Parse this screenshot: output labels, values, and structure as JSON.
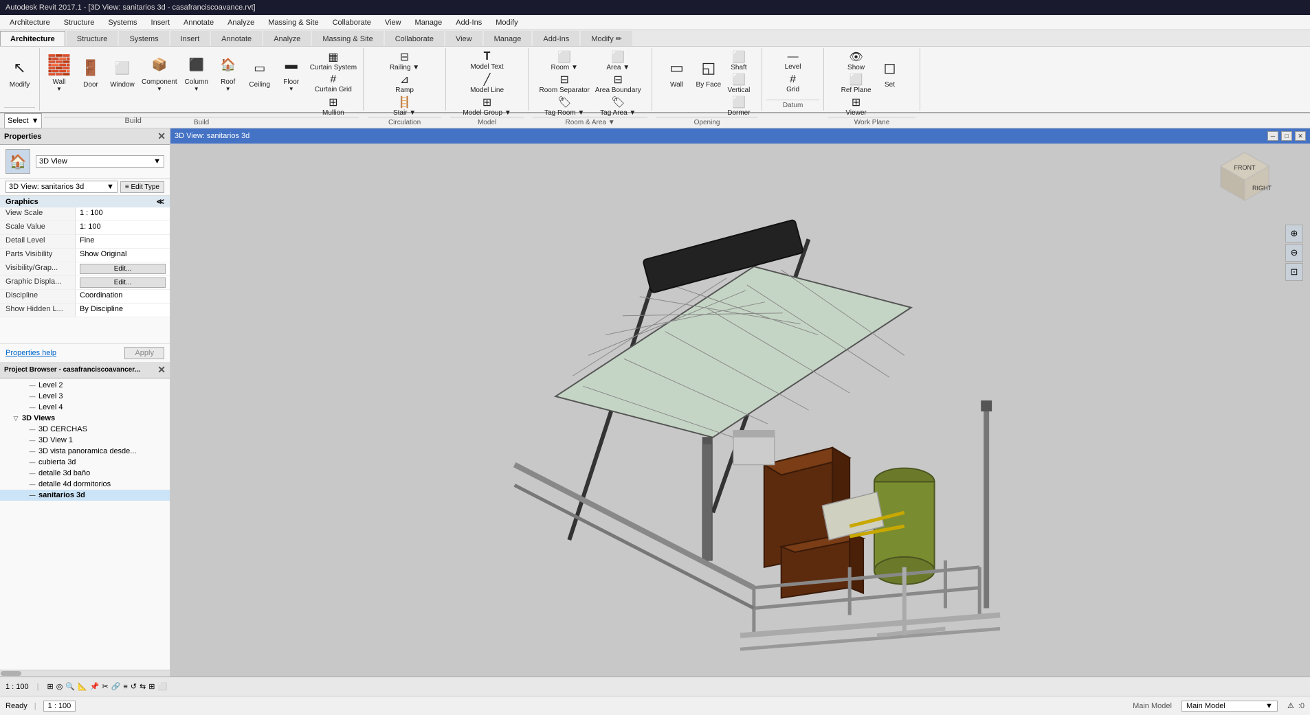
{
  "titleBar": {
    "text": "Autodesk Revit 2017.1 - [3D View: sanitarios 3d - casafranciscoavance.rvt]"
  },
  "menuBar": {
    "items": [
      "Architecture",
      "Structure",
      "Systems",
      "Insert",
      "Annotate",
      "Analyze",
      "Massing & Site",
      "Collaborate",
      "View",
      "Manage",
      "Add-Ins",
      "Modify"
    ]
  },
  "ribbon": {
    "activeTab": "Architecture",
    "tabs": [
      "Architecture",
      "Structure",
      "Systems",
      "Insert",
      "Annotate",
      "Analyze",
      "Massing & Site",
      "Collaborate",
      "View",
      "Manage",
      "Add-Ins",
      "Modify"
    ],
    "groups": {
      "select": {
        "label": ""
      },
      "build": {
        "label": "Build",
        "buttons": [
          {
            "label": "Wall",
            "icon": "🧱"
          },
          {
            "label": "Door",
            "icon": "🚪"
          },
          {
            "label": "Window",
            "icon": "⬜"
          },
          {
            "label": "Component",
            "icon": "📦"
          },
          {
            "label": "Column",
            "icon": "⬜"
          },
          {
            "label": "Roof",
            "icon": "🏠"
          },
          {
            "label": "Ceiling",
            "icon": "⬜"
          },
          {
            "label": "Floor",
            "icon": "⬜"
          },
          {
            "label": "Curtain System",
            "icon": "⬜"
          },
          {
            "label": "Curtain Grid",
            "icon": "⬜"
          },
          {
            "label": "Mullion",
            "icon": "⬜"
          }
        ]
      },
      "circulation": {
        "label": "Circulation",
        "buttons": [
          {
            "label": "Railing",
            "icon": "🚧"
          },
          {
            "label": "Ramp",
            "icon": "⬜"
          },
          {
            "label": "Stair",
            "icon": "🪜"
          }
        ]
      },
      "model": {
        "label": "Model",
        "buttons": [
          {
            "label": "Model Text",
            "icon": "T"
          },
          {
            "label": "Model Line",
            "icon": "⬜"
          },
          {
            "label": "Model Group",
            "icon": "⬜"
          }
        ]
      },
      "roomAndArea": {
        "label": "Room & Area",
        "buttons": [
          {
            "label": "Room",
            "icon": "⬜"
          },
          {
            "label": "Room Separator",
            "icon": "⬜"
          },
          {
            "label": "Tag Room",
            "icon": "⬜"
          },
          {
            "label": "Area",
            "icon": "⬜"
          },
          {
            "label": "Area Boundary",
            "icon": "⬜"
          },
          {
            "label": "Tag Area",
            "icon": "⬜"
          }
        ]
      },
      "opening": {
        "label": "Opening",
        "buttons": [
          {
            "label": "Wall",
            "icon": "⬜"
          },
          {
            "label": "By Face",
            "icon": "⬜"
          },
          {
            "label": "Shaft",
            "icon": "⬜"
          },
          {
            "label": "Vertical",
            "icon": "⬜"
          },
          {
            "label": "Dormer",
            "icon": "⬜"
          }
        ]
      },
      "datum": {
        "label": "Datum",
        "buttons": [
          {
            "label": "Level",
            "icon": "⬜"
          },
          {
            "label": "Grid",
            "icon": "⬜"
          }
        ]
      },
      "workPlane": {
        "label": "Work Plane",
        "buttons": [
          {
            "label": "Show",
            "icon": "⬜"
          },
          {
            "label": "Set",
            "icon": "⬜"
          },
          {
            "label": "Ref Plane",
            "icon": "⬜"
          },
          {
            "label": "Viewer",
            "icon": "⬜"
          }
        ]
      }
    }
  },
  "selectBar": {
    "label": "Select",
    "dropdownArrow": "▼"
  },
  "properties": {
    "title": "Properties",
    "closeBtn": "✕",
    "viewType": "3D View",
    "viewName": "3D View: sanitarios 3d",
    "editTypeBtn": "Edit Type",
    "sectionLabel": "Graphics",
    "rows": [
      {
        "label": "View Scale",
        "value": "1 : 100"
      },
      {
        "label": "Scale Value",
        "value": "1:  100"
      },
      {
        "label": "Detail Level",
        "value": "Fine"
      },
      {
        "label": "Parts Visibility",
        "value": "Show Original"
      },
      {
        "label": "Visibility/Grap...",
        "value": "Edit...",
        "isBtn": true
      },
      {
        "label": "Graphic Displa...",
        "value": "Edit...",
        "isBtn": true
      },
      {
        "label": "Discipline",
        "value": "Coordination"
      },
      {
        "label": "Show Hidden L...",
        "value": "By Discipline"
      }
    ],
    "helpLink": "Properties help",
    "applyBtn": "Apply"
  },
  "projectBrowser": {
    "title": "Project Browser - casafranciscoavancer...",
    "closeBtn": "✕",
    "items": [
      {
        "indent": 2,
        "label": "Level 2",
        "hasChildren": false
      },
      {
        "indent": 2,
        "label": "Level 3",
        "hasChildren": false
      },
      {
        "indent": 2,
        "label": "Level 4",
        "hasChildren": false
      },
      {
        "indent": 1,
        "label": "3D Views",
        "hasChildren": true,
        "expanded": true
      },
      {
        "indent": 2,
        "label": "3D CERCHAS",
        "hasChildren": false
      },
      {
        "indent": 2,
        "label": "3D View 1",
        "hasChildren": false
      },
      {
        "indent": 2,
        "label": "3D vista panoramica desde...",
        "hasChildren": false
      },
      {
        "indent": 2,
        "label": "cubierta 3d",
        "hasChildren": false
      },
      {
        "indent": 2,
        "label": "detalle 3d baño",
        "hasChildren": false
      },
      {
        "indent": 2,
        "label": "detalle 4d dormitorios",
        "hasChildren": false
      },
      {
        "indent": 2,
        "label": "sanitarios 3d",
        "hasChildren": false,
        "bold": true
      }
    ]
  },
  "canvasWindow": {
    "titleText": "3D View: sanitarios 3d",
    "minBtn": "─",
    "maxBtn": "□",
    "closeBtn": "✕"
  },
  "navCube": {
    "labels": {
      "front": "FRONT",
      "right": "RIGHT"
    }
  },
  "statusBar": {
    "scale": "1 : 100",
    "icons": [
      "grid",
      "snap",
      "zoom",
      "measure",
      "pin",
      "split",
      "link",
      "align",
      "rotate",
      "mirror",
      "array",
      "group",
      "lock",
      "tag"
    ],
    "readyText": "Ready"
  },
  "bottomBar": {
    "scale": "1 : 100",
    "modelName": "Main Model",
    "warningCount": "0"
  }
}
